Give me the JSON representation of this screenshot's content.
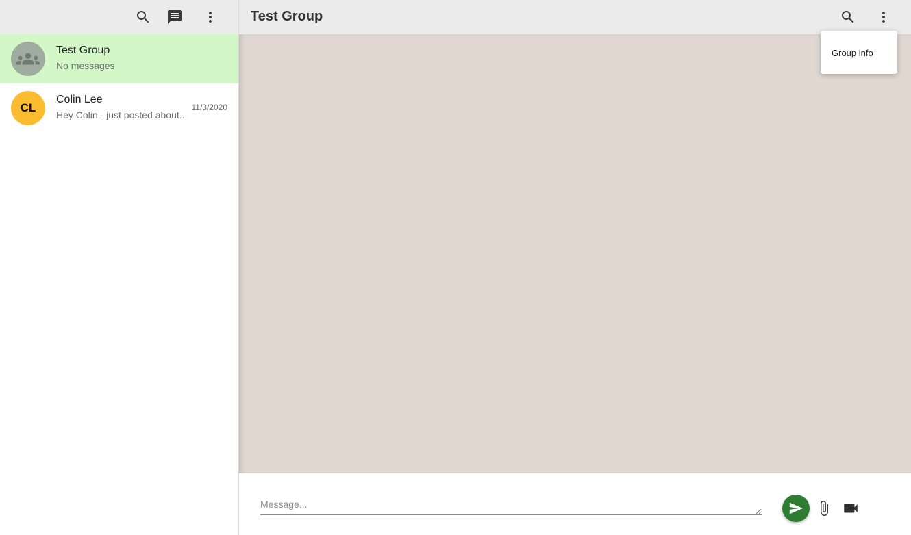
{
  "sidebar": {
    "header_icons": [
      "search-icon",
      "new-chat-icon",
      "more-vert-icon"
    ],
    "chats": [
      {
        "name": "Test Group",
        "subtitle": "No messages",
        "date": "",
        "avatar_type": "group-icon",
        "active": true
      },
      {
        "name": "Colin Lee",
        "subtitle": "Hey Colin - just posted about...",
        "date": "11/3/2020",
        "avatar_initials": "CL",
        "avatar_color": "#fbbd2f",
        "active": false
      }
    ]
  },
  "main": {
    "title": "Test Group",
    "header_icons": [
      "search-icon",
      "more-vert-icon"
    ],
    "menu": {
      "items": [
        "Group info"
      ]
    },
    "composer": {
      "placeholder": "Message...",
      "value": "",
      "send_icon": "send-icon",
      "attach_icon": "attach-icon",
      "video_icon": "video-icon"
    }
  },
  "colors": {
    "header_bg": "#ebebeb",
    "active_chat_bg": "#d3f7c7",
    "messages_bg": "#e1d9d1",
    "send_button": "#2e7d32"
  }
}
